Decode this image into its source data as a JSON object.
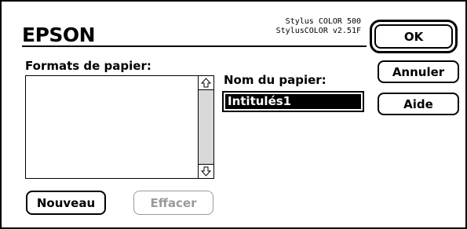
{
  "window": {
    "brand": "EPSON",
    "model_line1": "Stylus COLOR 500",
    "model_line2": "StylusCOLOR v2.51F"
  },
  "formats": {
    "label": "Formats de papier:",
    "items": []
  },
  "paper_name": {
    "label": "Nom du papier:",
    "value": "Intitulés1"
  },
  "buttons": {
    "ok": "OK",
    "cancel": "Annuler",
    "help": "Aide",
    "new": "Nouveau",
    "delete": "Effacer"
  },
  "icons": {
    "scroll_up": "scroll-up-arrow-icon",
    "scroll_down": "scroll-down-arrow-icon"
  }
}
